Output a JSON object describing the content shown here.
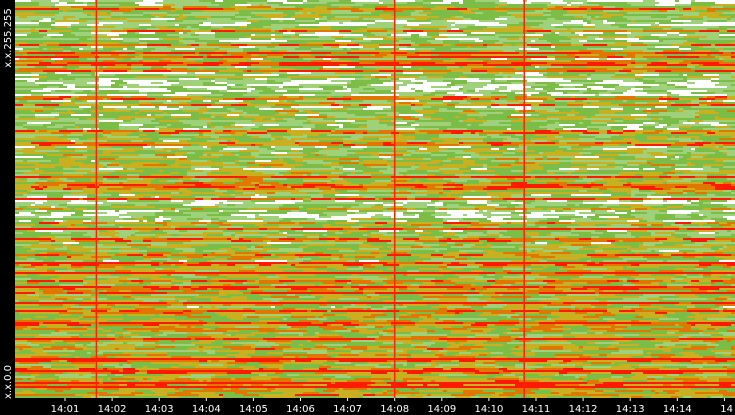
{
  "chart_data": {
    "type": "heatmap",
    "title": "",
    "xlabel": "",
    "ylabel": "",
    "y_ticks": [
      {
        "label": "x.x.255.255",
        "value": 255
      },
      {
        "label": "x.x.0.0",
        "value": 0
      }
    ],
    "x_ticks": [
      "14:01",
      "14:02",
      "14:03",
      "14:04",
      "14:05",
      "14:06",
      "14:07",
      "14:08",
      "14:09",
      "14:10",
      "14:11",
      "14:12",
      "14:13",
      "14:14",
      "14"
    ],
    "vertical_markers": [
      "14:01:40",
      "14:08:00",
      "14:10:45"
    ],
    "hot_rows_fraction_from_top": [
      0.02,
      0.11,
      0.13,
      0.14,
      0.155,
      0.16,
      0.175,
      0.245,
      0.33,
      0.36,
      0.46,
      0.465,
      0.47,
      0.6,
      0.64,
      0.66,
      0.72,
      0.78,
      0.81,
      0.85,
      0.9,
      0.93,
      0.97
    ],
    "color_scale": [
      "#ffffff",
      "#9fd07a",
      "#7cbd47",
      "#c9b020",
      "#e07800",
      "#ff1a00"
    ],
    "colors": {
      "background": "#000000",
      "axis_text": "#ffffff",
      "marker": "#ff2200"
    }
  }
}
